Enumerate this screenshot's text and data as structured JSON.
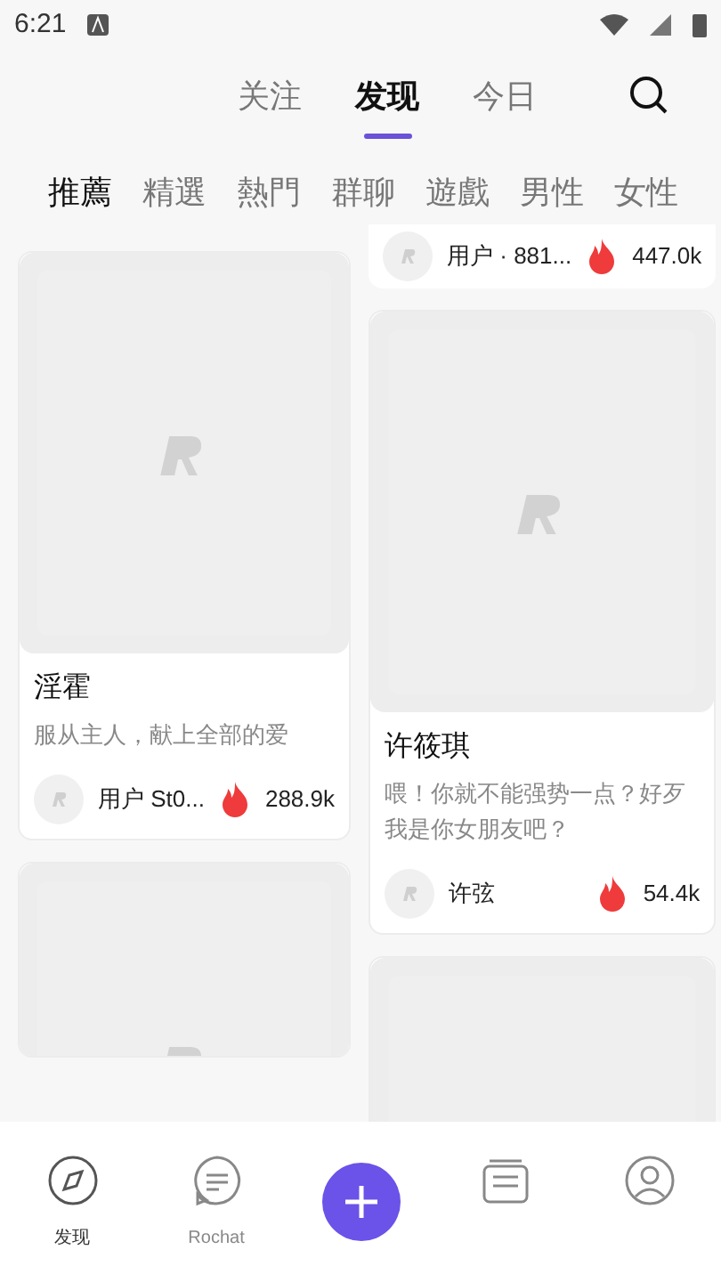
{
  "status_bar": {
    "time": "6:21"
  },
  "top_tabs": [
    {
      "label": "关注",
      "selected": false
    },
    {
      "label": "发现",
      "selected": true
    },
    {
      "label": "今日",
      "selected": false
    }
  ],
  "categories": [
    {
      "label": "推薦",
      "selected": true
    },
    {
      "label": "精選",
      "selected": false
    },
    {
      "label": "熱門",
      "selected": false
    },
    {
      "label": "群聊",
      "selected": false
    },
    {
      "label": "遊戲",
      "selected": false
    },
    {
      "label": "男性",
      "selected": false
    },
    {
      "label": "女性",
      "selected": false
    }
  ],
  "columns": [
    [
      {
        "title": "淫霍",
        "description": "服从主人，献上全部的爱",
        "author": "用户 St0...",
        "count": "288.9k"
      },
      {
        "kind": "picture_only"
      }
    ],
    [
      {
        "kind": "footer_only",
        "author": "用户 · 881...",
        "count": "447.0k"
      },
      {
        "title": "许筱琪",
        "description": "喂！你就不能强势一点？好歹我是你女朋友吧？",
        "author": "许弦",
        "count": "54.4k"
      },
      {
        "kind": "picture_only"
      }
    ]
  ],
  "bottom_nav": [
    {
      "kind": "compass",
      "label": "发现",
      "selected": true
    },
    {
      "kind": "chat",
      "label": "Rochat",
      "selected": false
    },
    {
      "kind": "add"
    },
    {
      "kind": "cards"
    },
    {
      "kind": "profile"
    }
  ]
}
